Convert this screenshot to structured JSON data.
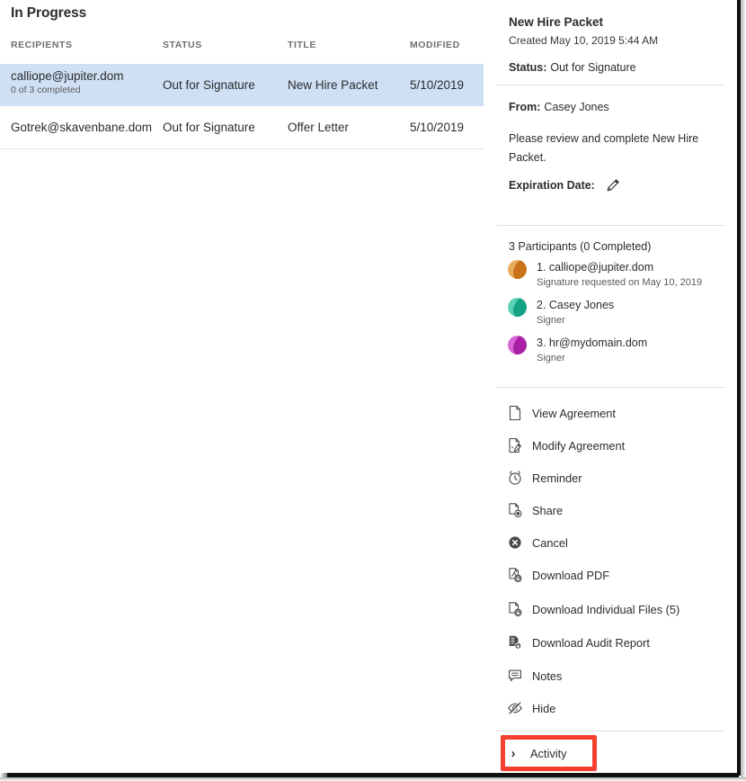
{
  "list": {
    "title": "In Progress",
    "columns": [
      "RECIPIENTS",
      "STATUS",
      "TITLE",
      "MODIFIED"
    ],
    "rows": [
      {
        "recipient": "calliope@jupiter.dom",
        "recipient_sub": "0 of 3 completed",
        "status": "Out for Signature",
        "doc_title": "New Hire Packet",
        "modified": "5/10/2019",
        "selected": true
      },
      {
        "recipient": "Gotrek@skavenbane.dom",
        "recipient_sub": "",
        "status": "Out for Signature",
        "doc_title": "Offer Letter",
        "modified": "5/10/2019",
        "selected": false
      }
    ]
  },
  "detail": {
    "title": "New Hire Packet",
    "created": "Created May 10, 2019 5:44 AM",
    "status_label": "Status:",
    "status_value": "Out for Signature",
    "from_label": "From:",
    "from_value": "Casey Jones",
    "message": "Please review and complete New Hire Packet.",
    "expiration_label": "Expiration Date:",
    "expiration_edit_icon": "pencil-icon"
  },
  "participants": {
    "heading": "3 Participants (0 Completed)",
    "items": [
      {
        "name": "1. calliope@jupiter.dom",
        "role": "Signature requested on May 10, 2019",
        "color": "#E08A1E",
        "color_dark": "#C8731A",
        "avatar_icon": "avatar-circle-orange"
      },
      {
        "name": "2. Casey Jones",
        "role": "Signer",
        "color": "#1BBF9C",
        "color_dark": "#14A184",
        "avatar_icon": "avatar-circle-teal"
      },
      {
        "name": "3. hr@mydomain.dom",
        "role": "Signer",
        "color": "#CB28C8",
        "color_dark": "#A81FA6",
        "avatar_icon": "avatar-circle-magenta"
      }
    ]
  },
  "actions": [
    {
      "label": "View Agreement",
      "icon": "document-icon"
    },
    {
      "label": "Modify Agreement",
      "icon": "document-pencil-icon"
    },
    {
      "label": "Reminder",
      "icon": "alarm-clock-icon"
    },
    {
      "label": "Share",
      "icon": "document-share-icon"
    },
    {
      "label": "Cancel",
      "icon": "cancel-circle-x-icon"
    },
    {
      "label": "Download PDF",
      "icon": "download-pdf-icon"
    },
    {
      "label": "Download Individual Files (5)",
      "icon": "download-file-icon"
    },
    {
      "label": "Download Audit Report",
      "icon": "download-report-icon"
    },
    {
      "label": "Notes",
      "icon": "speech-bubble-icon"
    },
    {
      "label": "Hide",
      "icon": "eye-slash-icon"
    }
  ],
  "activity": {
    "label": "Activity",
    "chevron": "›",
    "chevron_icon": "chevron-right-icon",
    "highlight_color": "#f4402f"
  },
  "colors": {
    "selected_row": "#cfe0f5",
    "divider": "#e2e2e2",
    "text": "#2c2c2c",
    "muted": "#5b5b5b",
    "header": "#6e6e6e"
  }
}
